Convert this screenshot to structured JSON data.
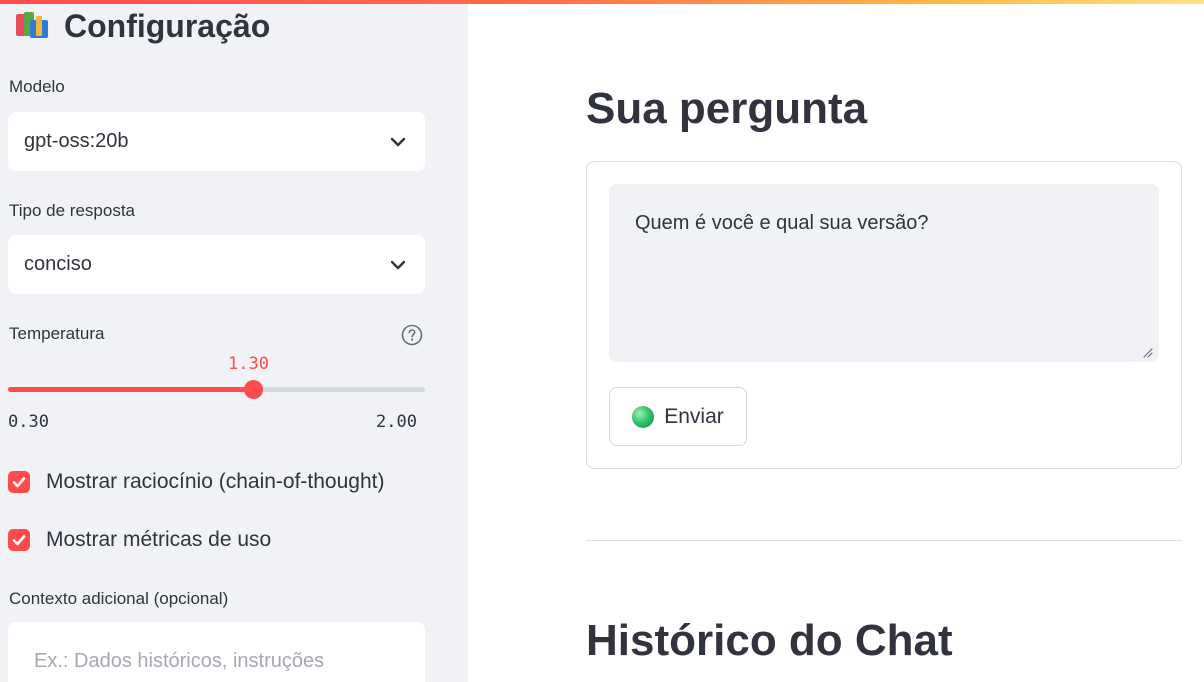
{
  "sidebar": {
    "title": "Configuração",
    "model": {
      "label": "Modelo",
      "value": "gpt-oss:20b"
    },
    "response_type": {
      "label": "Tipo de resposta",
      "value": "conciso"
    },
    "temperature": {
      "label": "Temperatura",
      "value": "1.30",
      "min": "0.30",
      "max": "2.00",
      "fraction": 0.588
    },
    "checkboxes": [
      {
        "label": "Mostrar raciocínio (chain-of-thought)",
        "checked": true
      },
      {
        "label": "Mostrar métricas de uso",
        "checked": true
      }
    ],
    "context": {
      "label": "Contexto adicional (opcional)",
      "placeholder": "Ex.: Dados históricos, instruções"
    }
  },
  "main": {
    "question_heading": "Sua pergunta",
    "question_text": "Quem é você e qual sua versão?",
    "send_label": "Enviar",
    "history_heading": "Histórico do Chat"
  },
  "colors": {
    "accent": "#ff4b4b",
    "sidebar_bg": "#f0f2f6",
    "text": "#31333f",
    "input_bg": "#f0f2f6"
  },
  "icons": [
    "books-icon",
    "chevron-down-icon",
    "help-icon",
    "checkmark-icon",
    "green-orb-icon",
    "resize-handle-icon"
  ]
}
